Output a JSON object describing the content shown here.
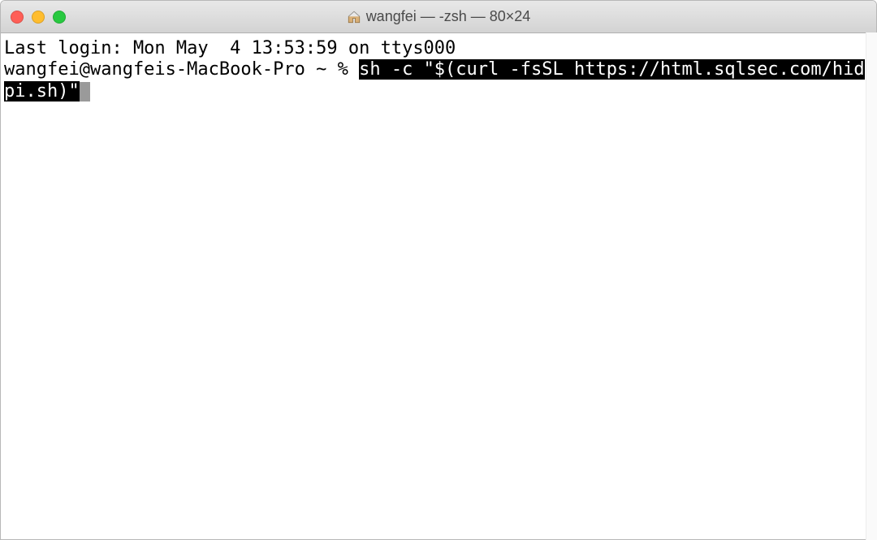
{
  "window": {
    "title": "wangfei — -zsh — 80×24"
  },
  "terminal": {
    "last_login_line": "Last login: Mon May  4 13:53:59 on ttys000",
    "prompt": "wangfei@wangfeis-MacBook-Pro ~ % ",
    "command_selected_part1": "sh -c \"$(curl -fsSL https://html.sqlsec.com/hid",
    "command_selected_part2": "pi.sh)\""
  }
}
